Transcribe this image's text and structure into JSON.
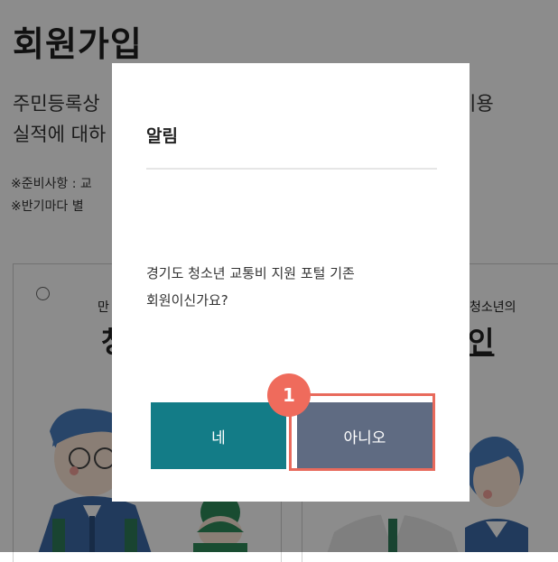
{
  "page": {
    "title": "회원가입",
    "intro_line1": "주민등록상",
    "intro_line2": "실적에 대하",
    "intro_right": "이용",
    "note1": "※준비사항 : 교",
    "note2": "※반기마다 별",
    "card_left_sub": "만",
    "card_left_big": "청",
    "card_right_sub": "청소년의",
    "card_right_big": "인"
  },
  "modal": {
    "title": "알림",
    "message": "경기도 청소년 교통비 지원 포털 기존\n회원이신가요?",
    "yes_label": "네",
    "no_label": "아니오"
  },
  "annotation": {
    "step_number": "1",
    "highlight_color": "#e86a5c"
  },
  "colors": {
    "yes_button": "#137c87",
    "no_button": "#5f6b82",
    "overlay": "rgba(0,0,0,0.45)"
  }
}
